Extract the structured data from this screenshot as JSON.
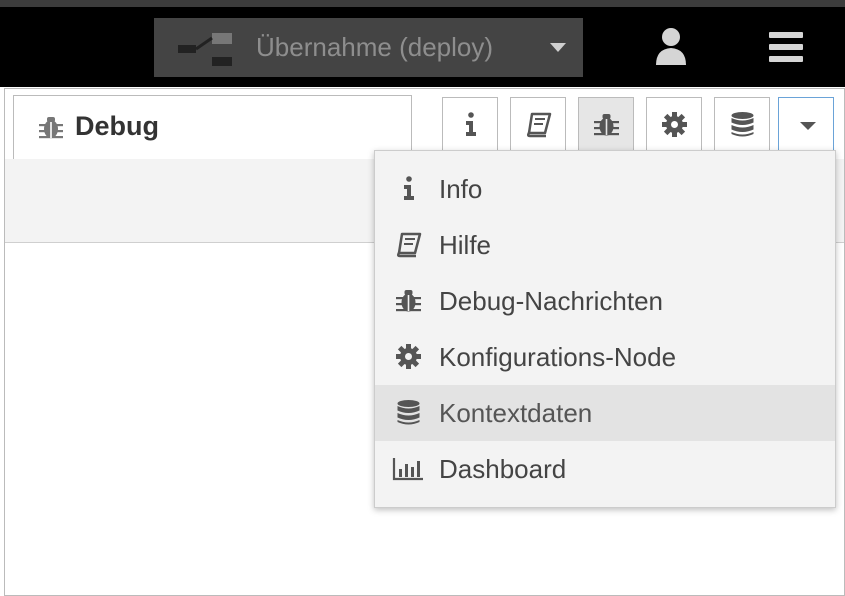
{
  "header": {
    "deploy_label": "Übernahme (deploy)"
  },
  "sidebar": {
    "active_tab_label": "Debug",
    "tab_buttons": [
      {
        "name": "info",
        "icon": "info-icon"
      },
      {
        "name": "help",
        "icon": "book-icon"
      },
      {
        "name": "debug",
        "icon": "bug-icon",
        "selected": true
      },
      {
        "name": "config",
        "icon": "gear-icon"
      },
      {
        "name": "context",
        "icon": "database-icon"
      },
      {
        "name": "more",
        "icon": "caret-down-icon"
      }
    ]
  },
  "dropdown": {
    "items": [
      {
        "label": "Info",
        "icon": "info-icon"
      },
      {
        "label": "Hilfe",
        "icon": "book-icon"
      },
      {
        "label": "Debug-Nachrichten",
        "icon": "bug-icon"
      },
      {
        "label": "Konfigurations-Node",
        "icon": "gear-icon"
      },
      {
        "label": "Kontextdaten",
        "icon": "database-icon",
        "highlighted": true
      },
      {
        "label": "Dashboard",
        "icon": "bar-chart-icon"
      }
    ]
  },
  "colors": {
    "header_bg": "#000000",
    "deploy_bg": "#444444",
    "deploy_text": "#8e8e8e",
    "dropdown_bg": "#f3f3f3",
    "dropdown_hover": "#e3e3e3",
    "icon_color": "#555555"
  }
}
